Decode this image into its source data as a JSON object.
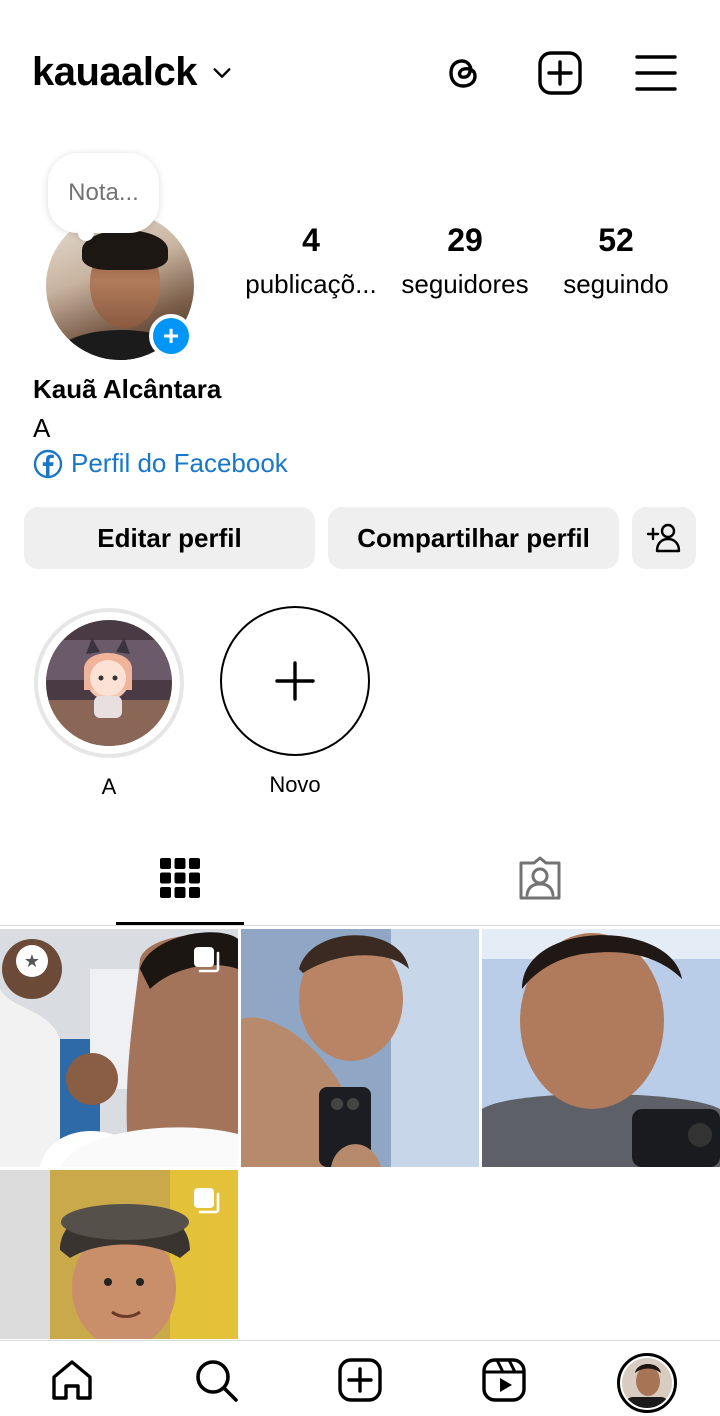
{
  "header": {
    "username": "kauaalck"
  },
  "note": {
    "placeholder": "Nota..."
  },
  "stats": [
    {
      "count": "4",
      "label": "publicaçõ..."
    },
    {
      "count": "29",
      "label": "seguidores"
    },
    {
      "count": "52",
      "label": "seguindo"
    }
  ],
  "profile": {
    "full_name": "Kauã Alcântara",
    "bio": "A",
    "facebook_link": "Perfil do Facebook"
  },
  "buttons": {
    "edit": "Editar perfil",
    "share": "Compartilhar perfil"
  },
  "highlights": [
    {
      "label": "A"
    },
    {
      "label": "Novo"
    }
  ],
  "colors": {
    "accent_blue": "#0095f6",
    "link_blue": "#1877c9",
    "button_bg": "#efefef"
  },
  "icons": {
    "header": [
      "threads-icon",
      "create-post-icon",
      "menu-icon"
    ],
    "tabs": [
      "grid-icon",
      "tagged-icon"
    ],
    "bottom_nav": [
      "home-icon",
      "search-icon",
      "create-icon",
      "reels-icon",
      "profile-avatar"
    ]
  }
}
